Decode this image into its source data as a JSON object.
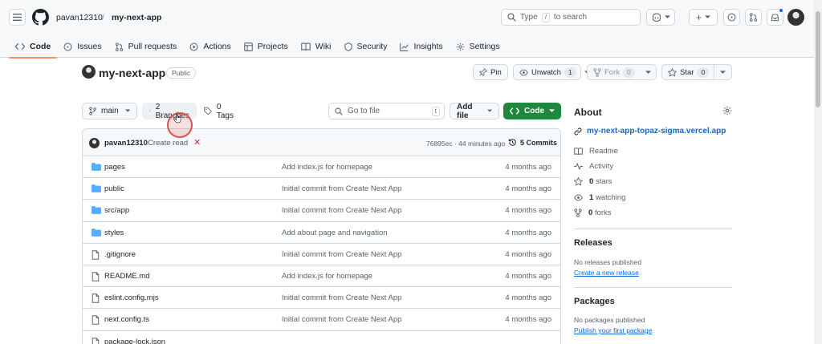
{
  "header": {
    "owner": "pavan12310",
    "separator": "/",
    "repo": "my-next-app",
    "search": {
      "prefix": "Type",
      "key": "/",
      "suffix": "to search"
    },
    "plus_label": "+"
  },
  "tabs": [
    {
      "label": "Code",
      "icon": "code-icon",
      "active": true
    },
    {
      "label": "Issues",
      "icon": "issue-icon"
    },
    {
      "label": "Pull requests",
      "icon": "pull-request-icon"
    },
    {
      "label": "Actions",
      "icon": "play-icon"
    },
    {
      "label": "Projects",
      "icon": "table-icon"
    },
    {
      "label": "Wiki",
      "icon": "book-icon"
    },
    {
      "label": "Security",
      "icon": "shield-icon"
    },
    {
      "label": "Insights",
      "icon": "graph-icon"
    },
    {
      "label": "Settings",
      "icon": "gear-icon"
    }
  ],
  "repo": {
    "name": "my-next-app",
    "visibility": "Public",
    "pin_label": "Pin",
    "watch_label": "Unwatch",
    "watch_count": "1",
    "fork_label": "Fork",
    "fork_count": "0",
    "star_label": "Star",
    "star_count": "0"
  },
  "toolbar": {
    "branch": "main",
    "branches": "2 Branches",
    "tags": "0 Tags",
    "goto_placeholder": "Go to file",
    "goto_key": "t",
    "add_file": "Add file",
    "code": "Code"
  },
  "latest_commit": {
    "author": "pavan12310",
    "message": "Create read",
    "status_symbol": "✕",
    "meta": "76895ec · 44 minutes ago",
    "commits": "5 Commits"
  },
  "files": [
    {
      "type": "dir",
      "name": "pages",
      "message": "Add index.js for homepage",
      "date": "4 months ago"
    },
    {
      "type": "dir",
      "name": "public",
      "message": "Initial commit from Create Next App",
      "date": "4 months ago"
    },
    {
      "type": "dir",
      "name": "src/app",
      "message": "Initial commit from Create Next App",
      "date": "4 months ago"
    },
    {
      "type": "dir",
      "name": "styles",
      "message": "Add about page and navigation",
      "date": "4 months ago"
    },
    {
      "type": "file",
      "name": ".gitignore",
      "message": "Initial commit from Create Next App",
      "date": "4 months ago"
    },
    {
      "type": "file",
      "name": "README.md",
      "message": "Add index.js for homepage",
      "date": "4 months ago"
    },
    {
      "type": "file",
      "name": "eslint.config.mjs",
      "message": "Initial commit from Create Next App",
      "date": "4 months ago"
    },
    {
      "type": "file",
      "name": "next.config.ts",
      "message": "Initial commit from Create Next App",
      "date": "4 months ago"
    },
    {
      "type": "file",
      "name": "package-lock.json",
      "message": "",
      "date": ""
    }
  ],
  "about": {
    "title": "About",
    "link": "my-next-app-topaz-sigma.vercel.app",
    "readme": "Readme",
    "activity": "Activity",
    "stars_num": "0",
    "stars_label": "stars",
    "watching_num": "1",
    "watching_label": "watching",
    "forks_num": "0",
    "forks_label": "forks"
  },
  "releases": {
    "title": "Releases",
    "empty": "No releases published",
    "create": "Create a new release"
  },
  "packages": {
    "title": "Packages",
    "empty": "No packages published",
    "publish": "Publish your first package"
  },
  "colors": {
    "accent": "#0969da",
    "green": "#1f883d",
    "tab_underline": "#fd8c73",
    "folder": "#54aeff",
    "error": "#d1242f"
  }
}
